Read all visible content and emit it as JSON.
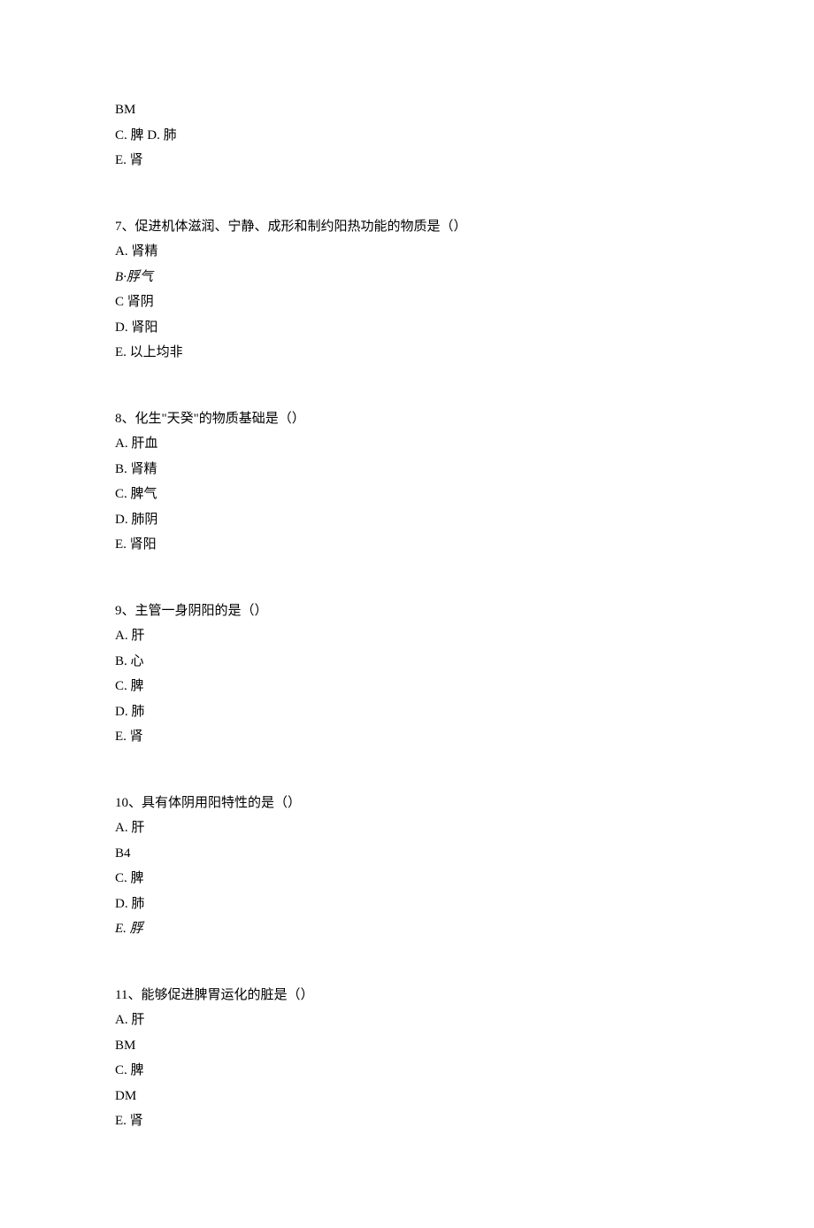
{
  "blocks": [
    {
      "lines": [
        {
          "text": "BM",
          "italic": false
        },
        {
          "text": "C. 脾 D. 肺",
          "italic": false
        },
        {
          "text": "E. 肾",
          "italic": false
        }
      ]
    },
    {
      "lines": [
        {
          "text": "7、促进机体滋润、宁静、成形和制约阳热功能的物质是（）",
          "italic": false
        },
        {
          "text": "A. 肾精",
          "italic": false
        },
        {
          "text": "B·脬气",
          "italic": true
        },
        {
          "text": "C 肾阴",
          "italic": false
        },
        {
          "text": "D. 肾阳",
          "italic": false
        },
        {
          "text": "E. 以上均非",
          "italic": false
        }
      ]
    },
    {
      "lines": [
        {
          "text": "8、化生\"天癸\"的物质基础是（）",
          "italic": false
        },
        {
          "text": "A. 肝血",
          "italic": false
        },
        {
          "text": "B. 肾精",
          "italic": false
        },
        {
          "text": "C. 脾气",
          "italic": false
        },
        {
          "text": "D. 肺阴",
          "italic": false
        },
        {
          "text": "E. 肾阳",
          "italic": false
        }
      ]
    },
    {
      "lines": [
        {
          "text": "9、主管一身阴阳的是（）",
          "italic": false
        },
        {
          "text": "A. 肝",
          "italic": false
        },
        {
          "text": "B. 心",
          "italic": false
        },
        {
          "text": "C. 脾",
          "italic": false
        },
        {
          "text": "D. 肺",
          "italic": false
        },
        {
          "text": "E. 肾",
          "italic": false
        }
      ]
    },
    {
      "lines": [
        {
          "text": "10、具有体阴用阳特性的是（）",
          "italic": false
        },
        {
          "text": "A. 肝",
          "italic": false
        },
        {
          "text": "B4",
          "italic": false
        },
        {
          "text": "C. 脾",
          "italic": false
        },
        {
          "text": "D. 肺",
          "italic": false
        },
        {
          "text": "E. 脬",
          "italic": true
        }
      ]
    },
    {
      "lines": [
        {
          "text": "11、能够促进脾胃运化的脏是（）",
          "italic": false
        },
        {
          "text": "A. 肝",
          "italic": false
        },
        {
          "text": "BM",
          "italic": false
        },
        {
          "text": "C. 脾",
          "italic": false
        },
        {
          "text": "DM",
          "italic": false
        },
        {
          "text": "E. 肾",
          "italic": false
        }
      ]
    }
  ]
}
